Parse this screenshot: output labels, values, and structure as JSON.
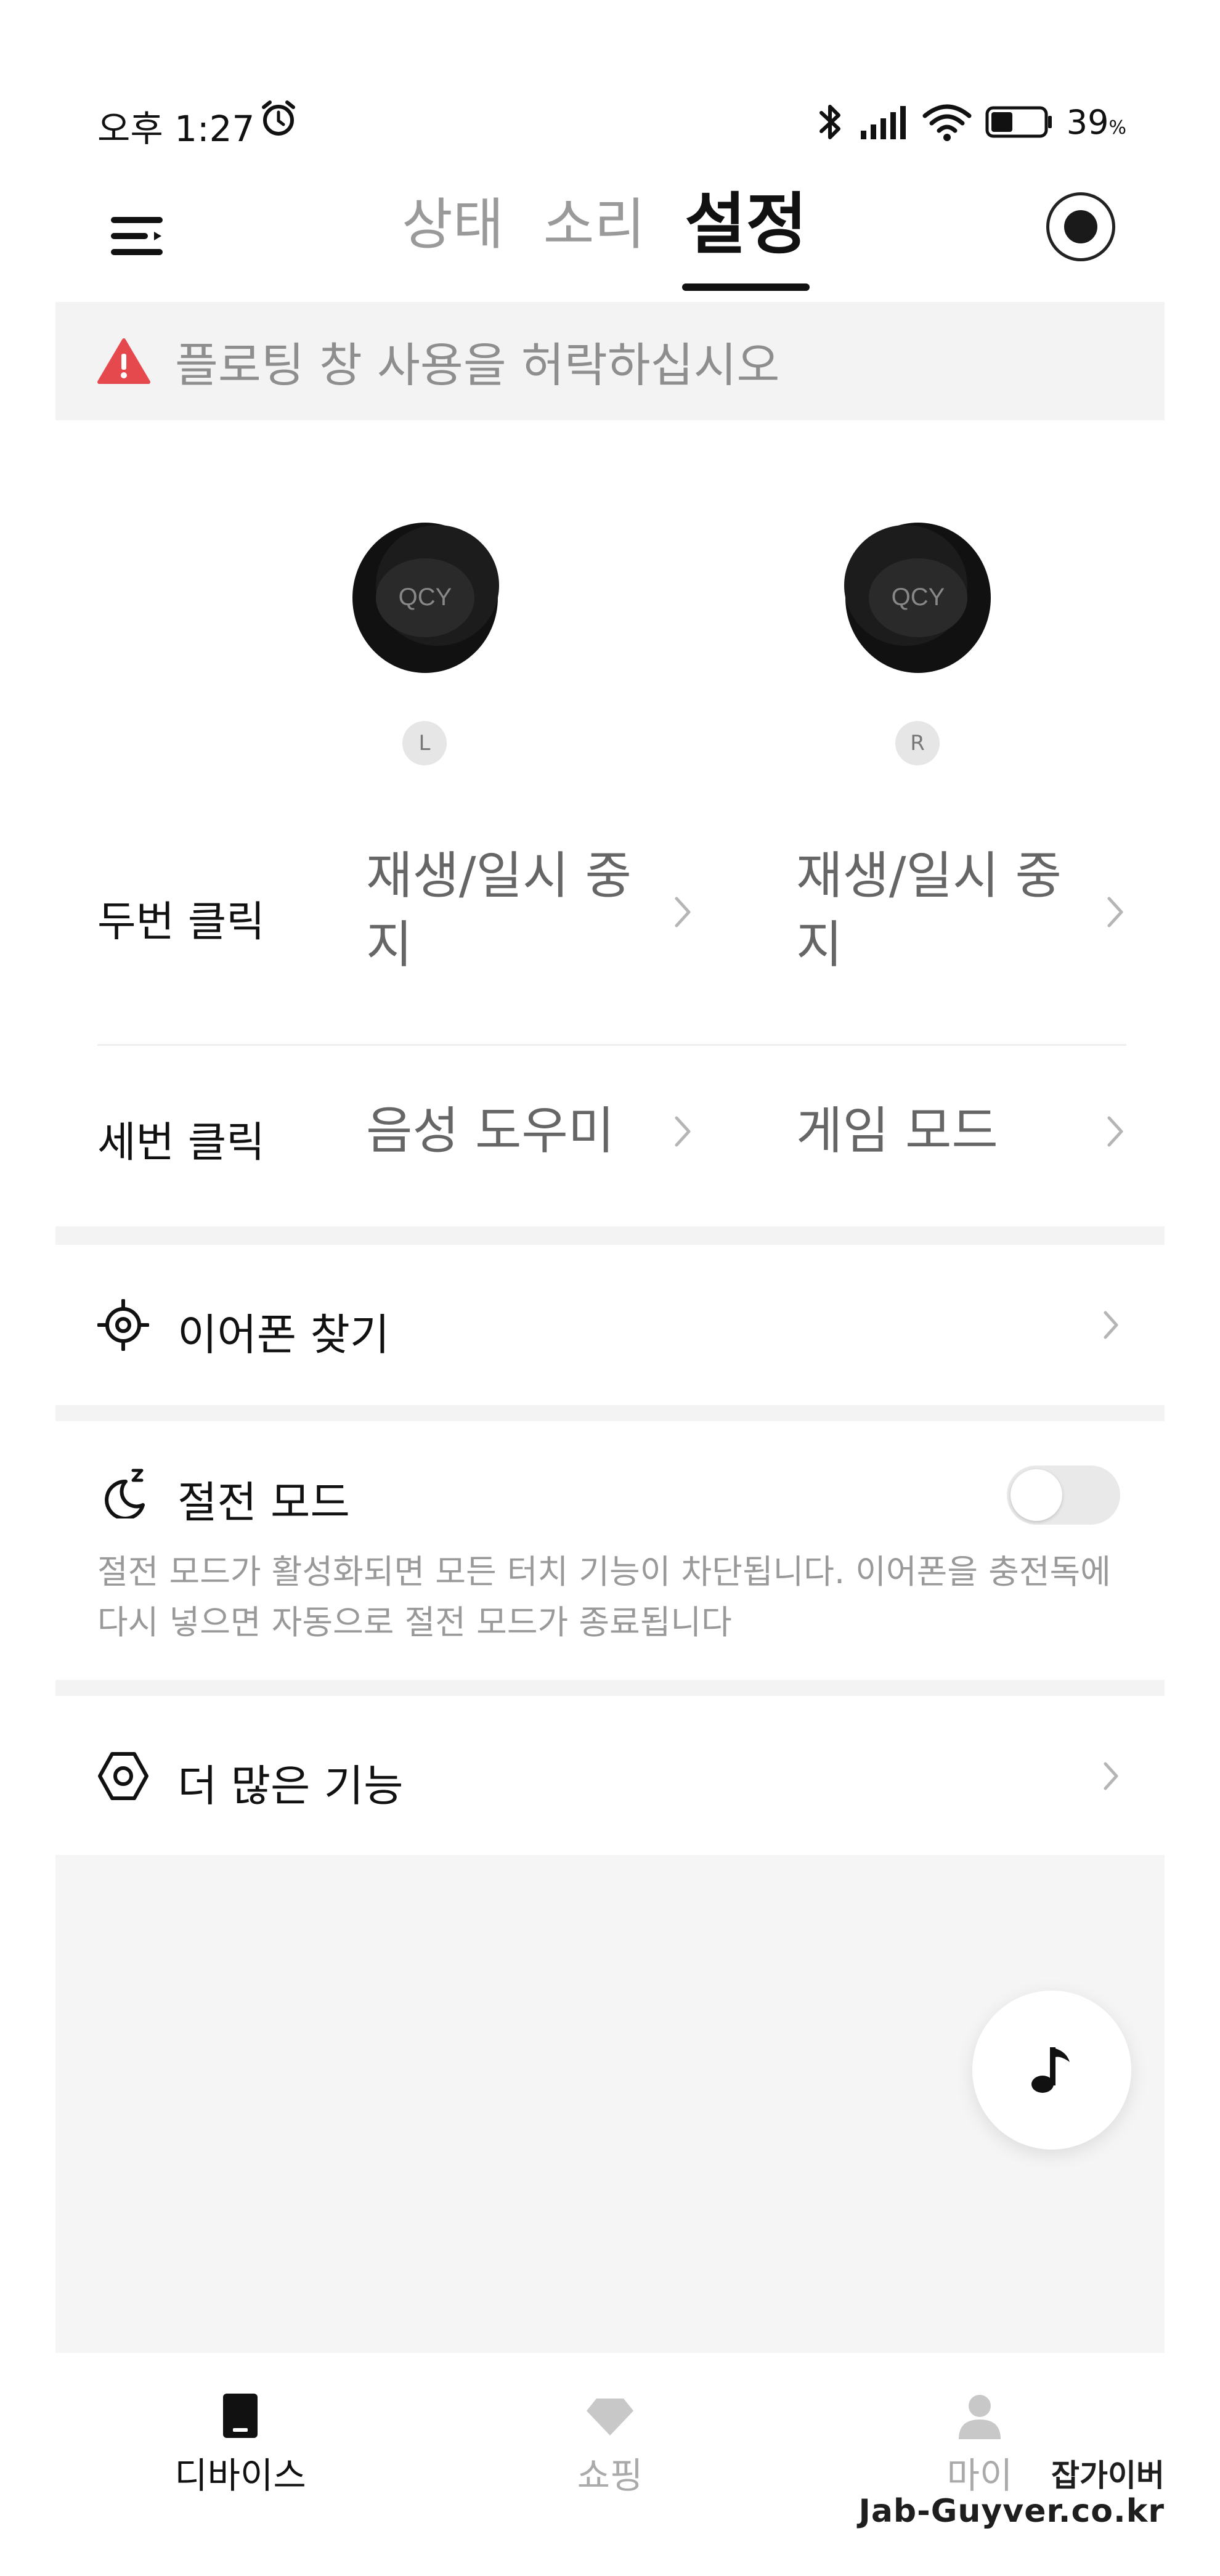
{
  "status_bar": {
    "time": "오후 1:27",
    "battery_percent": "39",
    "battery_unit": "%"
  },
  "header": {
    "tabs": [
      {
        "label": "상태",
        "active": false
      },
      {
        "label": "소리",
        "active": false
      },
      {
        "label": "설정",
        "active": true
      }
    ]
  },
  "warning": {
    "text": "플로팅 창 사용을 허락하십시오",
    "color": "#e5484d"
  },
  "earbuds": {
    "left_label": "L",
    "right_label": "R"
  },
  "controls": {
    "double_click": {
      "title": "두번 클릭",
      "left_value": "재생/일시 중지",
      "right_value": "재생/일시 중지"
    },
    "triple_click": {
      "title": "세번 클릭",
      "left_value": "음성 도우미",
      "right_value": "게임 모드"
    }
  },
  "find_earphones": {
    "title": "이어폰 찾기",
    "icon": "target-icon"
  },
  "power_saving": {
    "title": "절전 모드",
    "icon": "moon-sleep-icon",
    "enabled": false,
    "description": "절전 모드가 활성화되면 모든 터치 기능이 차단됩니다. 이어폰을 충전독에 다시 넣으면 자동으로 절전 모드가 종료됩니다"
  },
  "more_features": {
    "title": "더 많은 기능",
    "icon": "hexagon-icon"
  },
  "bottom_nav": {
    "items": [
      {
        "label": "디바이스",
        "icon": "device-icon",
        "active": true
      },
      {
        "label": "쇼핑",
        "icon": "diamond-icon",
        "active": false
      },
      {
        "label": "마이",
        "icon": "person-icon",
        "active": false
      }
    ]
  },
  "watermark": {
    "line1": "잡가이버",
    "line2": "Jab-Guyver.co.kr"
  }
}
